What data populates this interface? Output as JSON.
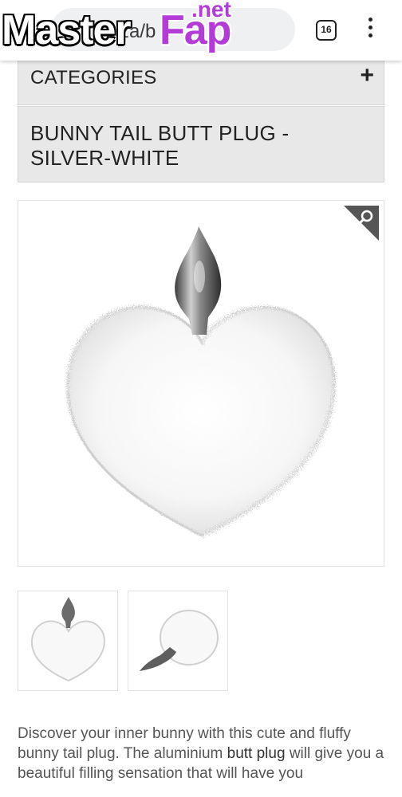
{
  "browser": {
    "url_fragment": "za/b",
    "tab_count": "16",
    "back_icon": "arrow-left-icon",
    "menu_icon": "kebab-menu-icon"
  },
  "watermark": {
    "part1": "Master",
    "part2": "Fap",
    "part3": ".net"
  },
  "categories": {
    "label": "CATEGORIES",
    "expand_symbol": "+"
  },
  "product": {
    "title": "BUNNY TAIL BUTT PLUG - SILVER-WHITE",
    "zoom_icon": "magnifier-icon"
  },
  "description": {
    "before_link": "Discover your inner bunny with this cute and fluffy bunny tail plug. The aluminium ",
    "link_text": "butt plug",
    "after_link": " will give you a beautiful filling sensation that will have you"
  },
  "colors": {
    "header_bg": "#e8e8e8",
    "zoom_corner": "#555555",
    "watermark_accent": "#b33bd8"
  }
}
